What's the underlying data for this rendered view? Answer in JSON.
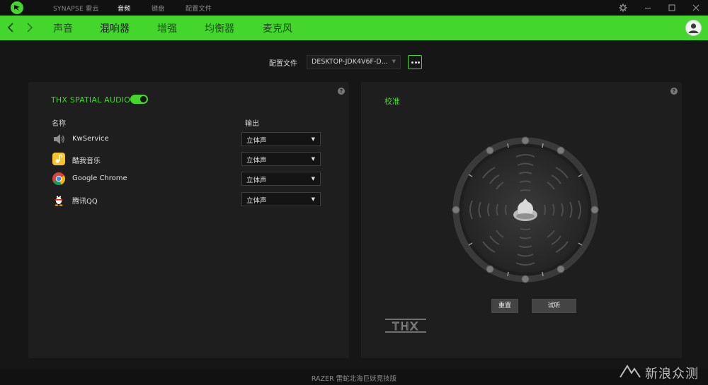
{
  "titlebar": {
    "tabs": [
      {
        "label": "SYNAPSE 雷云",
        "active": false
      },
      {
        "label": "音频",
        "active": true
      },
      {
        "label": "键盘",
        "active": false
      },
      {
        "label": "配置文件",
        "active": false
      }
    ]
  },
  "nav": {
    "tabs": [
      {
        "label": "声音",
        "active": false
      },
      {
        "label": "混响器",
        "active": true
      },
      {
        "label": "增强",
        "active": false
      },
      {
        "label": "均衡器",
        "active": false
      },
      {
        "label": "麦克风",
        "active": false
      }
    ]
  },
  "profile": {
    "label": "配置文件",
    "selected": "DESKTOP-JDK4V6F-D..."
  },
  "mixer": {
    "title": "THX SPATIAL AUDIO",
    "toggle_on": true,
    "col_name": "名称",
    "col_output": "输出",
    "apps": [
      {
        "name": "KwService",
        "icon": "speaker-icon",
        "output": "立体声"
      },
      {
        "name": "酷我音乐",
        "icon": "kuwo-music-icon",
        "output": "立体声"
      },
      {
        "name": "Google Chrome",
        "icon": "chrome-icon",
        "output": "立体声"
      },
      {
        "name": "腾讯QQ",
        "icon": "qq-penguin-icon",
        "output": "立体声"
      }
    ]
  },
  "calibration": {
    "title": "校准",
    "reset_label": "重置",
    "test_label": "试听",
    "brand_logo": "THX"
  },
  "footer": {
    "device": "RAZER 雷蛇北海巨妖竞技版"
  },
  "watermark": {
    "text": "新浪众测"
  },
  "colors": {
    "accent": "#44d62c",
    "background": "#161616",
    "panel": "#1e1e1e"
  }
}
